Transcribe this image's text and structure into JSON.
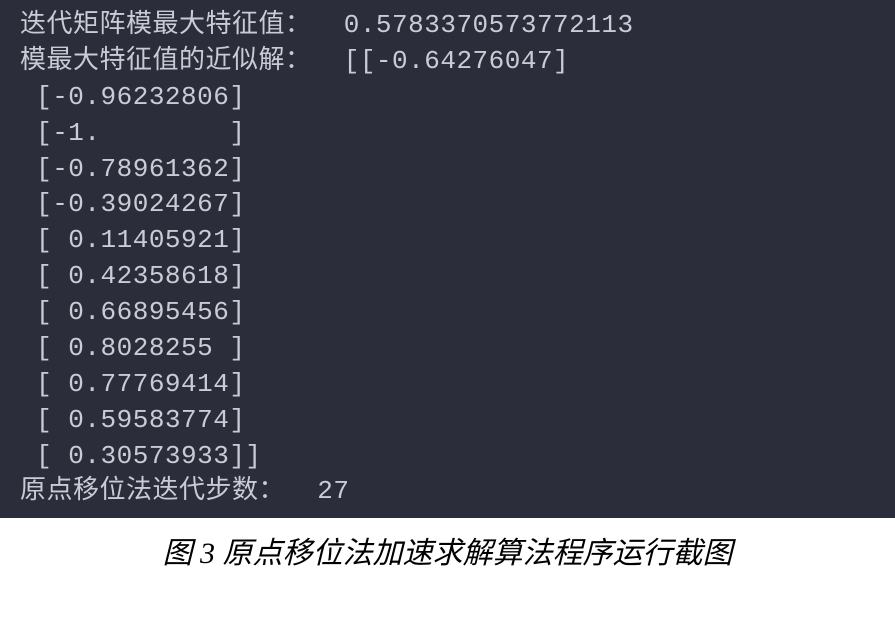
{
  "terminal": {
    "line1_label": "迭代矩阵模最大特征值：",
    "line1_value": "  0.5783370573772113",
    "line2_label": "模最大特征值的近似解：",
    "line2_value": "  [[-0.64276047]",
    "vec0": " [-0.96232806]",
    "vec1": " [-1.        ]",
    "vec2": " [-0.78961362]",
    "vec3": " [-0.39024267]",
    "vec4": " [ 0.11405921]",
    "vec5": " [ 0.42358618]",
    "vec6": " [ 0.66895456]",
    "vec7": " [ 0.8028255 ]",
    "vec8": " [ 0.77769414]",
    "vec9": " [ 0.59583774]",
    "vec10": " [ 0.30573933]]",
    "line_last_label": "原点移位法迭代步数：",
    "line_last_value": "  27"
  },
  "caption": {
    "text": "图 3 原点移位法加速求解算法程序运行截图"
  }
}
